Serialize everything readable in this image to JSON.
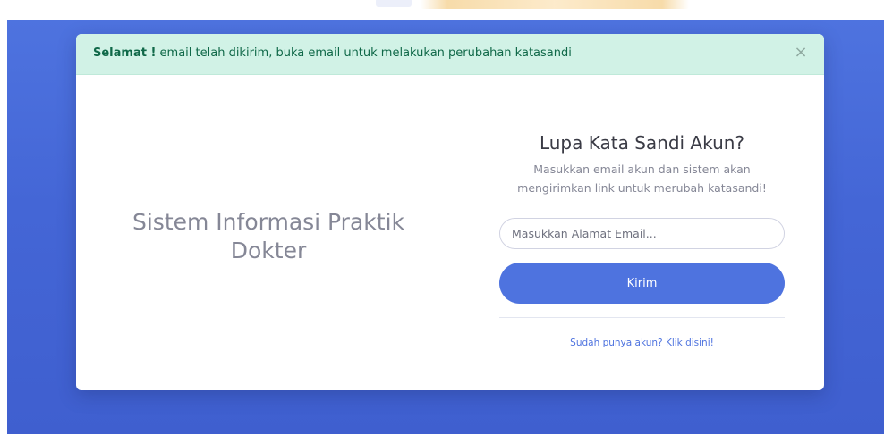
{
  "alert": {
    "strong_text": "Selamat !",
    "message": " email telah dikirim, buka email untuk melakukan perubahan katasandi",
    "close_symbol": "×"
  },
  "brand": {
    "title_line1": "Sistem Informasi Praktik",
    "title_line2": "Dokter"
  },
  "form": {
    "heading": "Lupa Kata Sandi Akun?",
    "subtitle_line1": "Masukkan email akun dan sistem akan",
    "subtitle_line2": "mengirimkan link untuk merubah katasandi!",
    "email_placeholder": "Masukkan Alamat Email...",
    "email_value": "",
    "submit_label": "Kirim",
    "login_link": "Sudah punya akun? Klik disini!"
  },
  "colors": {
    "primary": "#4e73df",
    "alert_bg": "#d1f2e6",
    "alert_text": "#0f6848"
  },
  "icons": {
    "close": "close-icon"
  }
}
